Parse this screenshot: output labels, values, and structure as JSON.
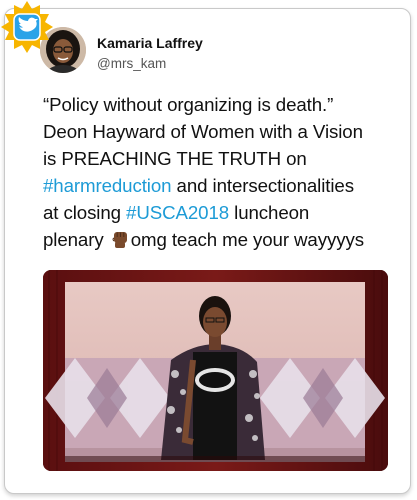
{
  "author": {
    "name": "Kamaria Laffrey",
    "handle": "@mrs_kam"
  },
  "icons": {
    "badge": "twitter-bird-icon",
    "emoji": "raised-fist-medium-dark-skin-emoji"
  },
  "tweet": {
    "line1": "“Policy without organizing is death.”",
    "line2": "Deon Hayward of Women with a Vision",
    "line3": "is PREACHING THE TRUTH on",
    "line4_tag": "#harmreduction",
    "line4_text": " and intersectionalities",
    "line5_text": "at closing ",
    "line5_tag": "#USCA2018",
    "line5_after": " luncheon",
    "line6_pre": "plenary ",
    "line6_post": "omg teach me your wayyyys"
  },
  "colors": {
    "hashtag": "#1d9bd6",
    "badge_sun": "#f7b500",
    "badge_blue": "#2aa3e8"
  }
}
